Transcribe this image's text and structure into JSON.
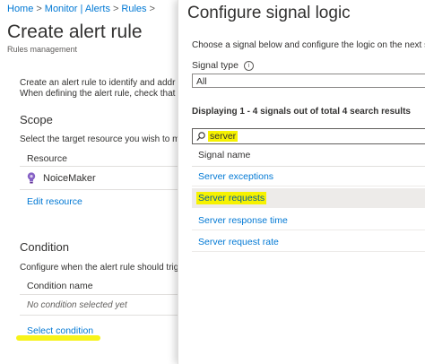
{
  "breadcrumb": {
    "items": [
      "Home",
      "Monitor | Alerts",
      "Rules"
    ],
    "separator": ">"
  },
  "page": {
    "title": "Create alert rule",
    "subtitle": "Rules management",
    "intro_line1": "Create an alert rule to identify and addr",
    "intro_line2": "When defining the alert rule, check that"
  },
  "scope": {
    "heading": "Scope",
    "description": "Select the target resource you wish to m",
    "column_header": "Resource",
    "resource_name": "NoiceMaker",
    "edit_link": "Edit resource"
  },
  "condition": {
    "heading": "Condition",
    "description": "Configure when the alert rule should trig",
    "column_header": "Condition name",
    "empty_text": "No condition selected yet",
    "select_link": "Select condition"
  },
  "panel": {
    "title": "Configure signal logic",
    "description": "Choose a signal below and configure the logic on the next s",
    "signal_type_label": "Signal type",
    "signal_type_value": "All",
    "display_count": "Displaying 1 - 4 signals out of total 4 search results",
    "search_value": "server",
    "column_header": "Signal name",
    "signals": [
      "Server exceptions",
      "Server requests",
      "Server response time",
      "Server request rate"
    ],
    "selected_index": 1
  },
  "colors": {
    "link": "#0078d4",
    "highlight": "#f6f200",
    "resource_icon": "#8661c5"
  },
  "icons": {
    "resource": "lightbulb-icon",
    "search": "search-icon",
    "info": "info-icon"
  }
}
